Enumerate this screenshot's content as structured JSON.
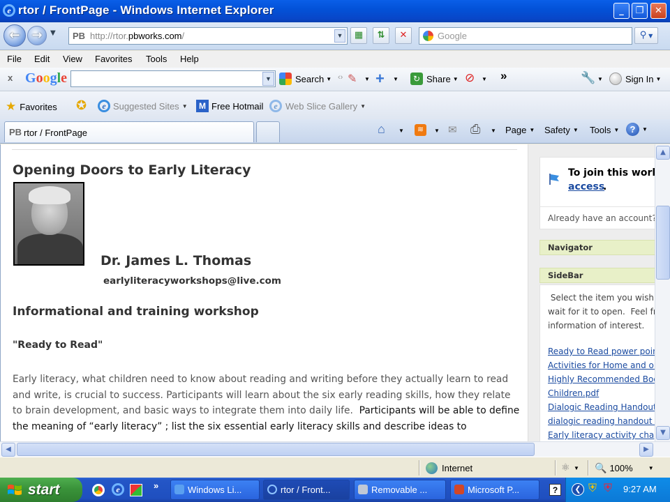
{
  "window": {
    "title": "rtor / FrontPage - Windows Internet Explorer",
    "minimize_glyph": "_",
    "maximize_glyph": "❐",
    "close_glyph": "✕"
  },
  "addressbar": {
    "pb_prefix": "PB",
    "url_scheme": "http://rtor.",
    "url_host": "pbworks.com",
    "url_path": "/",
    "search_placeholder": "Google"
  },
  "menu": {
    "items": [
      "File",
      "Edit",
      "View",
      "Favorites",
      "Tools",
      "Help"
    ]
  },
  "google_toolbar": {
    "close_glyph": "x",
    "logo": "Google",
    "search_label": "Search",
    "share_label": "Share",
    "more_glyph": "»",
    "signin_label": "Sign In"
  },
  "favorites_bar": {
    "favorites_label": "Favorites",
    "suggested_sites": "Suggested Sites",
    "free_hotmail": "Free Hotmail",
    "web_slice_gallery": "Web Slice Gallery"
  },
  "tabs": {
    "active_tab": "rtor / FrontPage",
    "tab_icon_text": "PB",
    "page_label": "Page",
    "safety_label": "Safety",
    "tools_label": "Tools"
  },
  "page": {
    "heading": "Opening Doors to Early Literacy",
    "author_name": "Dr. James L. Thomas",
    "author_email": "earlyliteracyworkshops@live.com",
    "section_title": "Informational and training workshop",
    "workshop_title": "\"Ready to Read\"",
    "para_line1": "Early literacy, what children need to know about reading and writing before they actually learn to read",
    "para_line2": "and write, is crucial to success.  Participants will learn about the six early reading skills, how they relate",
    "para_line3a": "to brain development, and basic ways to integrate them into daily life.  ",
    "para_line3b": "Participants will be able to define",
    "para_line4": "the meaning of  “early literacy” ; list the six essential early literacy skills and describe ideas to"
  },
  "sidebar": {
    "join_text": "To join this work",
    "access_link": "access",
    "access_period": ".",
    "already_text": "Already have an account?",
    "navigator_label": "Navigator",
    "sidebar_label": "SideBar",
    "body_line1": " Select the item you wish t",
    "body_line2": "wait for it to open.  Feel fre",
    "body_line3": "information of interest.",
    "links": [
      "Ready to Read power poin",
      "Activities for Home and or",
      "Highly Recommended Book",
      "Children.pdf",
      "Dialogic Reading Handout.p",
      "dialogic reading handout fo",
      "Early  literacy  activity  cha"
    ]
  },
  "statusbar": {
    "zone": "Internet",
    "zoom": "100%"
  },
  "taskbar": {
    "start_label": "start",
    "more_glyph": "»",
    "tasks": [
      {
        "label": "Windows Li...",
        "active": false
      },
      {
        "label": "rtor / Front...",
        "active": true
      },
      {
        "label": "Removable ...",
        "active": false
      },
      {
        "label": "Microsoft P...",
        "active": false
      }
    ],
    "clock": "9:27 AM",
    "help_glyph": "?"
  },
  "colors": {
    "titlebar": "#0352D8",
    "link": "#1A4AA0",
    "panel_head": "#E8F0C8",
    "taskbar": "#2456C7",
    "start": "#3A933A"
  },
  "icons": [
    "ie-icon",
    "back-arrow-icon",
    "forward-arrow-icon",
    "compatibility-icon",
    "refresh-icon",
    "stop-icon",
    "google-icon",
    "search-magnifier-icon",
    "star-icon",
    "home-icon",
    "rss-icon",
    "mail-icon",
    "print-icon",
    "help-icon",
    "globe-icon",
    "zoom-icon",
    "windows-flag-icon",
    "clock"
  ]
}
